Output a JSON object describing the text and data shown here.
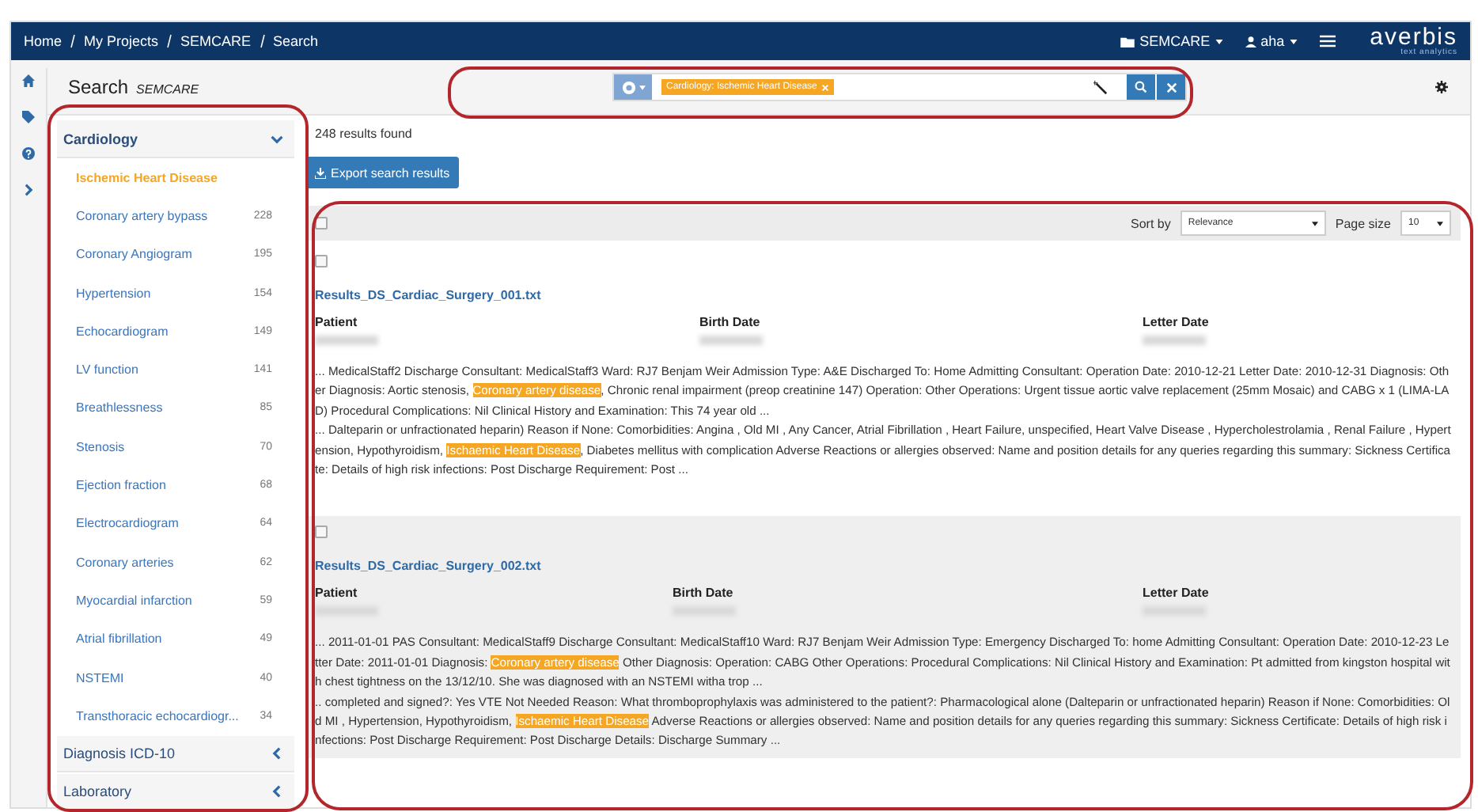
{
  "navbar": {
    "breadcrumb": [
      "Home",
      "My Projects",
      "SEMCARE",
      "Search"
    ],
    "project_menu": "SEMCARE",
    "user_menu": "aha",
    "logo": "averbis",
    "logo_tagline": "text analytics"
  },
  "page": {
    "title": "Search",
    "project": "SEMCARE"
  },
  "search": {
    "tags": [
      {
        "label": "Cardiology: Ischemic Heart Disease"
      }
    ]
  },
  "facets": [
    {
      "label": "Cardiology",
      "expanded": true,
      "items": [
        {
          "label": "Ischemic Heart Disease",
          "selected": true
        },
        {
          "label": "Coronary artery bypass",
          "count": "228",
          "selected": false
        },
        {
          "label": "Coronary Angiogram",
          "count": "195",
          "selected": false
        },
        {
          "label": "Hypertension",
          "count": "154",
          "selected": false
        },
        {
          "label": "Echocardiogram",
          "count": "149",
          "selected": false
        },
        {
          "label": "LV function",
          "count": "141",
          "selected": false
        },
        {
          "label": "Breathlessness",
          "count": "85",
          "selected": false
        },
        {
          "label": "Stenosis",
          "count": "70",
          "selected": false
        },
        {
          "label": "Ejection fraction",
          "count": "68",
          "selected": false
        },
        {
          "label": "Electrocardiogram",
          "count": "64",
          "selected": false
        },
        {
          "label": "Coronary arteries",
          "count": "62",
          "selected": false
        },
        {
          "label": "Myocardial infarction",
          "count": "59",
          "selected": false
        },
        {
          "label": "Atrial fibrillation",
          "count": "49",
          "selected": false
        },
        {
          "label": "NSTEMI",
          "count": "40",
          "selected": false
        },
        {
          "label": "Transthoracic echocardiogr...",
          "count": "34",
          "selected": false
        }
      ]
    },
    {
      "label": "Diagnosis ICD-10",
      "expanded": false
    },
    {
      "label": "Laboratory",
      "expanded": false
    }
  ],
  "results_count": "248 results found",
  "export_button": "Export search results",
  "toolbar": {
    "checked": false,
    "sort_label": "Sort by",
    "sort_value": "Relevance",
    "page_size_label": "Page size",
    "page_size_value": "10"
  },
  "results": [
    {
      "checked": false,
      "selected": false,
      "file": "Results_DS_Cardiac_Surgery_001.txt",
      "columns": [
        "Patient",
        "Birth Date",
        "Letter Date"
      ],
      "snippets": [
        [
          {
            "text": "... MedicalStaff2 Discharge Consultant: MedicalStaff3 Ward: RJ7 Benjam Weir Admission Type: A&E Discharged To: Home Admitting Consultant: Operation Date: 2010-12-21 Letter Date: 2010-12-31 Diagnosis: Other Diagnosis: Aortic stenosis, ",
            "highlight": false
          },
          {
            "text": "Coronary artery disease",
            "highlight": true
          },
          {
            "text": ", Chronic renal impairment (preop creatinine 147) Operation: Other Operations: Urgent tissue aortic valve replacement (25mm Mosaic) and CABG x 1 (LIMA-LAD) Procedural Complications: Nil Clinical History and Examination: This 74 year old ...",
            "highlight": false
          }
        ],
        [
          {
            "text": "... Dalteparin or unfractionated heparin) Reason if None: Comorbidities: Angina , Old MI , Any Cancer, Atrial Fibrillation , Heart Failure, unspecified, Heart Valve Disease , Hypercholestrolamia , Renal Failure , Hypertension, Hypothyroidism, ",
            "highlight": false
          },
          {
            "text": "Ischaemic Heart Disease",
            "highlight": true
          },
          {
            "text": ", Diabetes mellitus with complication Adverse Reactions or allergies observed: Name and position details for any queries regarding this summary: Sickness Certificate: Details of high risk infections: Post Discharge Requirement: Post ...",
            "highlight": false
          }
        ]
      ]
    },
    {
      "checked": false,
      "selected": true,
      "file": "Results_DS_Cardiac_Surgery_002.txt",
      "columns": [
        "Patient",
        "Birth Date",
        "Letter Date"
      ],
      "snippets": [
        [
          {
            "text": "... 2011-01-01 PAS Consultant: MedicalStaff9 Discharge Consultant: MedicalStaff10 Ward: RJ7 Benjam Weir Admission Type: Emergency Discharged To: home Admitting Consultant: Operation Date: 2010-12-23 Letter Date: 2011-01-01 Diagnosis: ",
            "highlight": false
          },
          {
            "text": "Coronary artery disease",
            "highlight": true
          },
          {
            "text": " Other Diagnosis: Operation: CABG Other Operations: Procedural Complications: Nil Clinical History and Examination: Pt admitted from kingston hospital with chest tightness on the 13/12/10. She was diagnosed with an NSTEMI witha trop ...",
            "highlight": false
          }
        ],
        [
          {
            "text": ".. completed and signed?: Yes VTE Not Needed Reason: What thromboprophylaxis was administered to the patient?: Pharmacological alone (Dalteparin or unfractionated heparin) Reason if None: Comorbidities: Old MI , Hypertension, Hypothyroidism, ",
            "highlight": false
          },
          {
            "text": "Ischaemic Heart Disease",
            "highlight": true
          },
          {
            "text": " Adverse Reactions or allergies observed: Name and position details for any queries regarding this summary: Sickness Certificate: Details of high risk infections: Post Discharge Requirement: Post Discharge Details: Discharge Summary ...",
            "highlight": false
          }
        ]
      ]
    }
  ]
}
